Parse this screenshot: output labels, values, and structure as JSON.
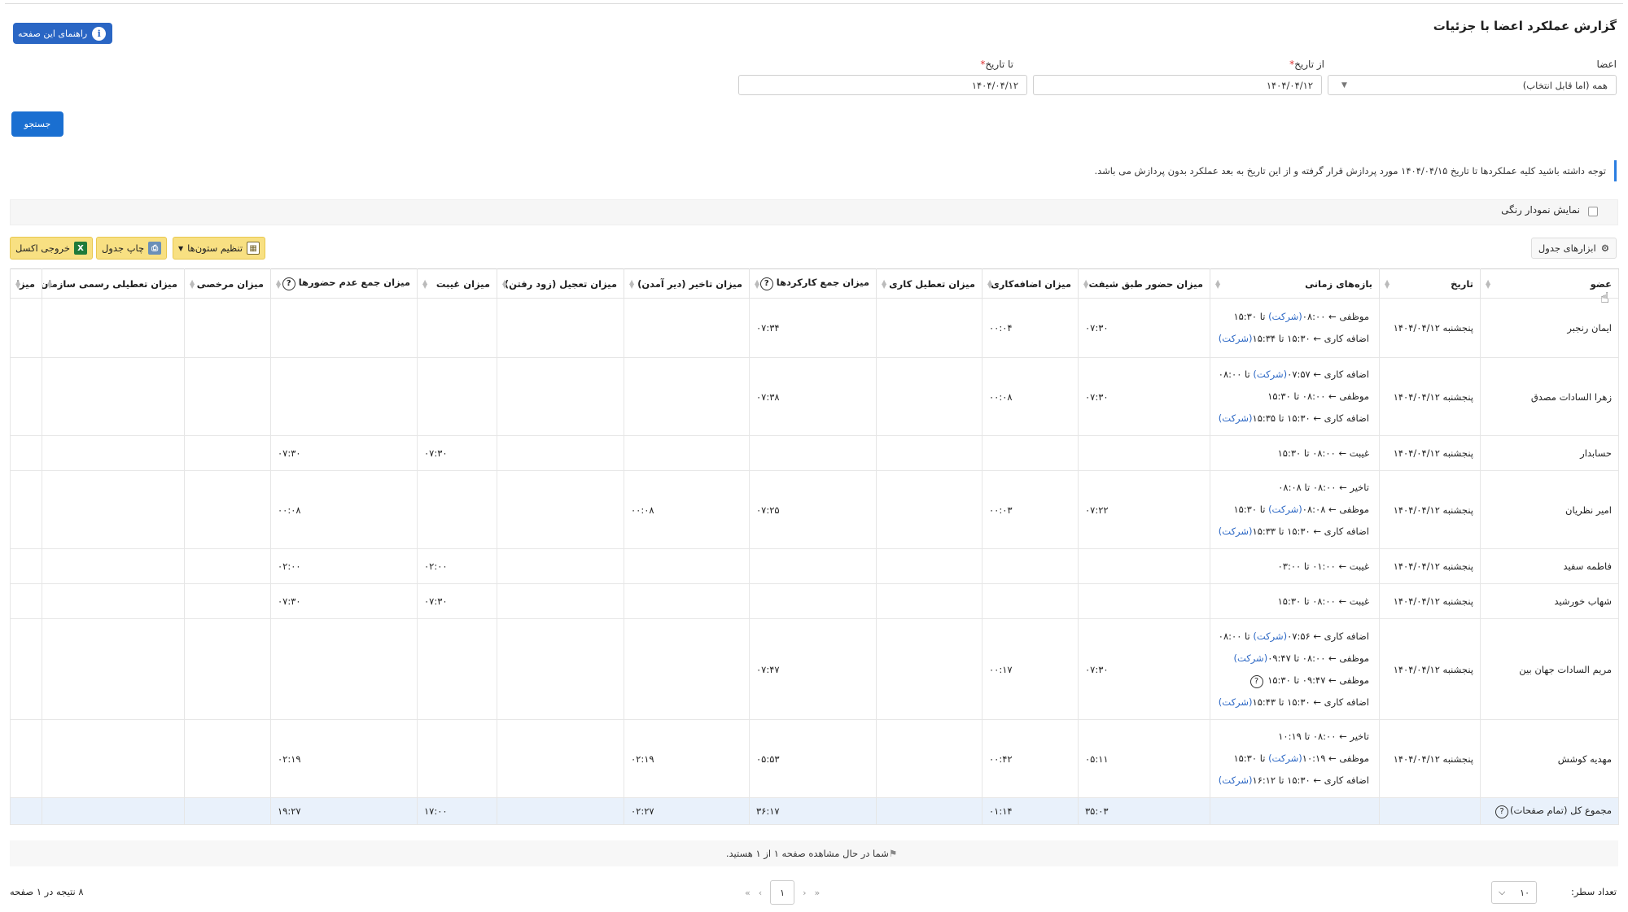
{
  "page": {
    "title": "گزارش عملکرد اعضا با جزئیات",
    "help_label": "راهنمای این صفحه"
  },
  "filters": {
    "members_label": "اعضا",
    "members_value": "همه (اما قابل انتخاب)",
    "from_label": "از تاریخ",
    "from_value": "۱۴۰۴/۰۴/۱۲",
    "to_label": "تا تاریخ",
    "to_value": "۱۴۰۴/۰۴/۱۲",
    "search_label": "جستجو"
  },
  "notice": "توجه داشته باشید کلیه عملکردها تا تاریخ ۱۴۰۴/۰۴/۱۵ مورد پردازش قرار گرفته و از این تاریخ به بعد عملکرد بدون پردازش می باشد.",
  "chart_toggle": {
    "label": "نمایش نمودار رنگی",
    "checked": false
  },
  "toolbar": {
    "tools_label": "ابزارهای جدول",
    "excel_label": "خروجی اکسل",
    "print_label": "چاپ جدول",
    "columns_label": "تنظیم ستون‌ها"
  },
  "table": {
    "headers": [
      "عضو",
      "تاریخ",
      "بازه‌های زمانی",
      "میزان حضور طبق شیفت",
      "میزان اضافه‌کاری",
      "میزان تعطیل کاری",
      "میزان جمع کارکردها",
      "میزان تاخیر (دیر آمدن)",
      "میزان تعجیل (زود رفتن)",
      "میزان غیبت",
      "میزان جمع عدم حضورها",
      "میزان مرخصی",
      "میزان تعطیلی رسمی سازمان",
      "میزا"
    ],
    "rows": [
      {
        "member": "ایمان رنجبر",
        "date": "پنجشنبه ۱۴۰۴/۰۴/۱۲",
        "intervals": [
          "موظفی ← ۰۸:۰۰(شرکت) تا ۱۵:۳۰",
          "اضافه کاری ← ۱۵:۳۰ تا ۱۵:۳۴(شرکت)"
        ],
        "shift": "۰۷:۳۰",
        "overtime": "۰۰:۰۴",
        "holiday": "",
        "total_work": "۰۷:۳۴",
        "late": "",
        "early": "",
        "absence": "",
        "total_absent": "",
        "leave": "",
        "official_holiday": ""
      },
      {
        "member": "زهرا السادات مصدق",
        "date": "پنجشنبه ۱۴۰۴/۰۴/۱۲",
        "intervals": [
          "اضافه کاری ← ۰۷:۵۷(شرکت) تا ۰۸:۰۰",
          "موظفی ← ۰۸:۰۰ تا ۱۵:۳۰",
          "اضافه کاری ← ۱۵:۳۰ تا ۱۵:۳۵(شرکت)"
        ],
        "shift": "۰۷:۳۰",
        "overtime": "۰۰:۰۸",
        "holiday": "",
        "total_work": "۰۷:۳۸",
        "late": "",
        "early": "",
        "absence": "",
        "total_absent": "",
        "leave": "",
        "official_holiday": ""
      },
      {
        "member": "حسابدار",
        "date": "پنجشنبه ۱۴۰۴/۰۴/۱۲",
        "intervals": [
          "غیبت ← ۰۸:۰۰ تا ۱۵:۳۰"
        ],
        "shift": "",
        "overtime": "",
        "holiday": "",
        "total_work": "",
        "late": "",
        "early": "",
        "absence": "۰۷:۳۰",
        "total_absent": "۰۷:۳۰",
        "leave": "",
        "official_holiday": ""
      },
      {
        "member": "امیر نظریان",
        "date": "پنجشنبه ۱۴۰۴/۰۴/۱۲",
        "intervals": [
          "تاخیر ← ۰۸:۰۰ تا ۰۸:۰۸",
          "موظفی ← ۰۸:۰۸(شرکت) تا ۱۵:۳۰",
          "اضافه کاری ← ۱۵:۳۰ تا ۱۵:۳۳(شرکت)"
        ],
        "shift": "۰۷:۲۲",
        "overtime": "۰۰:۰۳",
        "holiday": "",
        "total_work": "۰۷:۲۵",
        "late": "۰۰:۰۸",
        "early": "",
        "absence": "",
        "total_absent": "۰۰:۰۸",
        "leave": "",
        "official_holiday": ""
      },
      {
        "member": "فاطمه سفید",
        "date": "پنجشنبه ۱۴۰۴/۰۴/۱۲",
        "intervals": [
          "غیبت ← ۰۱:۰۰ تا ۰۳:۰۰"
        ],
        "shift": "",
        "overtime": "",
        "holiday": "",
        "total_work": "",
        "late": "",
        "early": "",
        "absence": "۰۲:۰۰",
        "total_absent": "۰۲:۰۰",
        "leave": "",
        "official_holiday": ""
      },
      {
        "member": "شهاب خورشید",
        "date": "پنجشنبه ۱۴۰۴/۰۴/۱۲",
        "intervals": [
          "غیبت ← ۰۸:۰۰ تا ۱۵:۳۰"
        ],
        "shift": "",
        "overtime": "",
        "holiday": "",
        "total_work": "",
        "late": "",
        "early": "",
        "absence": "۰۷:۳۰",
        "total_absent": "۰۷:۳۰",
        "leave": "",
        "official_holiday": ""
      },
      {
        "member": "مریم السادات جهان بین",
        "date": "پنجشنبه ۱۴۰۴/۰۴/۱۲",
        "intervals": [
          "اضافه کاری ← ۰۷:۵۶(شرکت) تا ۰۸:۰۰",
          "موظفی ← ۰۸:۰۰ تا ۰۹:۴۷(شرکت)",
          "موظفی ← ۰۹:۴۷ تا ۱۵:۳۰ (?)",
          "اضافه کاری ← ۱۵:۳۰ تا ۱۵:۴۳(شرکت)"
        ],
        "shift": "۰۷:۳۰",
        "overtime": "۰۰:۱۷",
        "holiday": "",
        "total_work": "۰۷:۴۷",
        "late": "",
        "early": "",
        "absence": "",
        "total_absent": "",
        "leave": "",
        "official_holiday": ""
      },
      {
        "member": "مهدیه کوشش",
        "date": "پنجشنبه ۱۴۰۴/۰۴/۱۲",
        "intervals": [
          "تاخیر ← ۰۸:۰۰ تا ۱۰:۱۹",
          "موظفی ← ۱۰:۱۹(شرکت) تا ۱۵:۳۰",
          "اضافه کاری ← ۱۵:۳۰ تا ۱۶:۱۲(شرکت)"
        ],
        "shift": "۰۵:۱۱",
        "overtime": "۰۰:۴۲",
        "holiday": "",
        "total_work": "۰۵:۵۳",
        "late": "۰۲:۱۹",
        "early": "",
        "absence": "",
        "total_absent": "۰۲:۱۹",
        "leave": "",
        "official_holiday": ""
      }
    ],
    "total": {
      "label": "مجموع کل (تمام صفحات)",
      "shift": "۳۵:۰۳",
      "overtime": "۰۱:۱۴",
      "holiday": "",
      "total_work": "۳۶:۱۷",
      "late": "۰۲:۲۷",
      "early": "",
      "absence": "۱۷:۰۰",
      "total_absent": "۱۹:۲۷",
      "leave": "",
      "official_holiday": ""
    }
  },
  "pagination": {
    "info": "شما در حال مشاهده صفحه ۱ از ۱ هستید.",
    "current_page": "۱",
    "rows_label": "تعداد سطر:",
    "rows_value": "۱۰",
    "results": "۸ نتیجه در ۱ صفحه"
  }
}
